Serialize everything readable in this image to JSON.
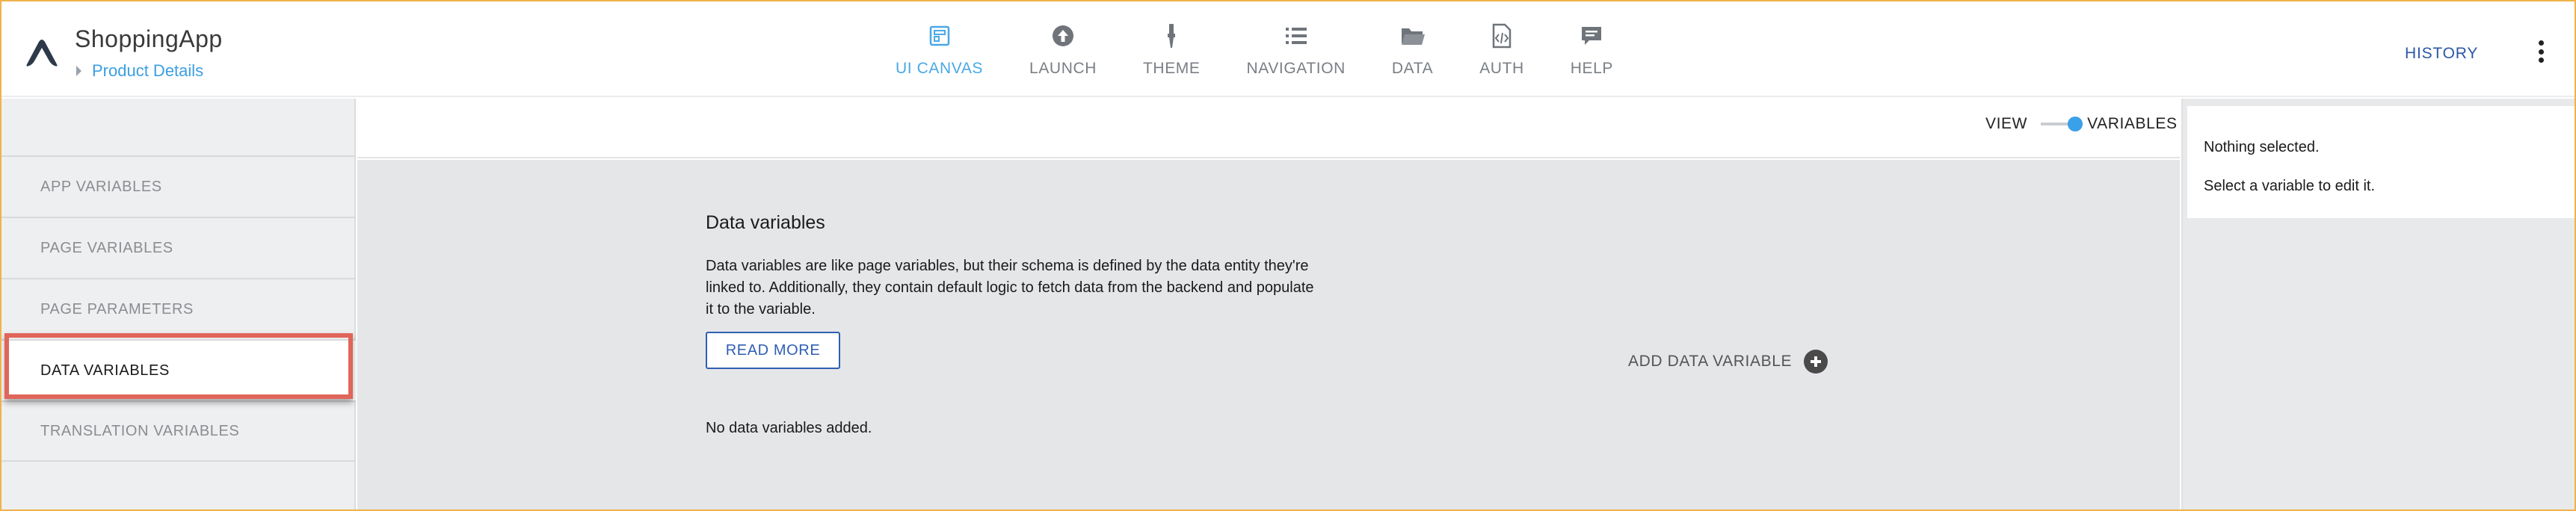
{
  "app": {
    "title": "ShoppingApp",
    "breadcrumb": "Product Details"
  },
  "nav": {
    "items": [
      {
        "label": "UI CANVAS",
        "icon": "canvas-icon",
        "active": true
      },
      {
        "label": "LAUNCH",
        "icon": "upload-icon",
        "active": false
      },
      {
        "label": "THEME",
        "icon": "brush-icon",
        "active": false
      },
      {
        "label": "NAVIGATION",
        "icon": "list-icon",
        "active": false
      },
      {
        "label": "DATA",
        "icon": "folder-icon",
        "active": false
      },
      {
        "label": "AUTH",
        "icon": "code-file-icon",
        "active": false
      },
      {
        "label": "HELP",
        "icon": "chat-icon",
        "active": false
      }
    ]
  },
  "header": {
    "history_label": "HISTORY",
    "more_icon": "kebab-menu-icon"
  },
  "sidebar": {
    "items": [
      {
        "label": "APP VARIABLES",
        "selected": false
      },
      {
        "label": "PAGE VARIABLES",
        "selected": false
      },
      {
        "label": "PAGE PARAMETERS",
        "selected": false
      },
      {
        "label": "DATA VARIABLES",
        "selected": true
      },
      {
        "label": "TRANSLATION VARIABLES",
        "selected": false
      }
    ]
  },
  "view_toggle": {
    "left_label": "VIEW",
    "right_label": "VARIABLES",
    "state": "VARIABLES"
  },
  "main": {
    "title": "Data variables",
    "description": "Data variables are like page variables, but their schema is defined by the data entity they're linked to. Additionally, they contain default logic to fetch data from the backend and populate it to the variable.",
    "read_more_label": "READ MORE",
    "empty_text": "No data variables added.",
    "add_label": "ADD DATA VARIABLE"
  },
  "right_panel": {
    "line1": "Nothing selected.",
    "line2": "Select a variable to edit it."
  },
  "colors": {
    "accent_active": "#4aa8e6",
    "link_blue": "#2f5fb3",
    "highlight": "#e0655a",
    "toggle_knob": "#3aa0e8"
  }
}
